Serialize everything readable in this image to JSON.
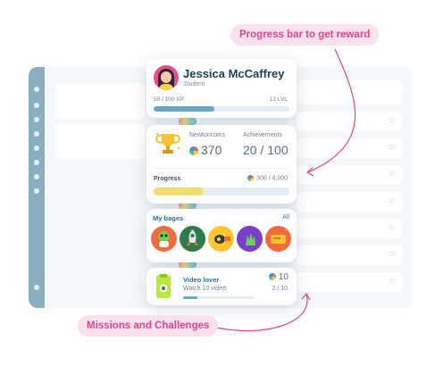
{
  "profile": {
    "name": "Jessica McCaffrey",
    "role": "Student",
    "xp": "50 / 100 XP",
    "level": "12 LVL",
    "xp_fraction": 0.45
  },
  "stats": {
    "newtoncoins_label": "Newtoncoins",
    "newtoncoins_value": "370",
    "achievements_label": "Achievements",
    "achievements_value": "20 / 100",
    "progress_label": "Progress",
    "progress_count": "300 / 4,000",
    "progress_fraction": 0.36
  },
  "badges": {
    "title": "My bages",
    "all_label": "All",
    "items": [
      {
        "icon": "alien-badge-icon",
        "color": "#f36b3b"
      },
      {
        "icon": "rocket-badge-icon",
        "color": "#2f7a48"
      },
      {
        "icon": "satellite-badge-icon",
        "color": "#ffc52e"
      },
      {
        "icon": "monster-hand-badge-icon",
        "color": "#7a3fc8"
      },
      {
        "icon": "ticket-badge-icon",
        "color": "#f36b3b"
      }
    ]
  },
  "mission": {
    "title": "Video lover",
    "subtitle": "Watch 10 video",
    "reward": "10",
    "count": "2 / 10",
    "fraction": 0.2
  },
  "annotations": {
    "top": "Progress bar to get reward",
    "bottom": "Missions and Challenges"
  },
  "colors": {
    "accent": "#2f6d8f",
    "pink": "#e0478f",
    "xp_bar": "#6aa7c4",
    "progress_bar": "#f1dd6d"
  }
}
